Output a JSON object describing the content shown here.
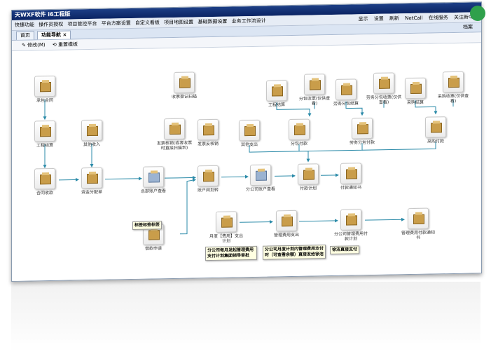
{
  "title": "天WXF软件 i6工程版",
  "menu": [
    "快捷功能",
    "操作员授权",
    "项目管控平台",
    "平台方案设置",
    "自定义看板",
    "项目地图设置",
    "基础数据设置",
    "业务工作流设计"
  ],
  "right_menu": [
    "显示",
    "设置",
    "刷新",
    "NetCall",
    "在线服务",
    "关注新中大"
  ],
  "right_extra": "档案",
  "tabs": [
    "首页",
    "功能导航"
  ],
  "toolbar": {
    "edit": "修改(M)",
    "reset": "重置模板"
  },
  "nodes": {
    "n1": "承包合同",
    "n2": "工程结算",
    "n3": "其他收入",
    "n4": "合同收款",
    "n5": "资金分配单",
    "n6": "收票登记扫描",
    "n7": "发票核销(或者收票时直接扫描到)",
    "n8": "发票反核销",
    "n9": "总部账户查看",
    "n10": "借款申请",
    "n11": "账户间划转",
    "n12": "分公司账户查看",
    "n13": "工程结算",
    "n14": "分包收票(仅供查看)",
    "n15": "劳务分包结算",
    "n16": "劳务分包收票(仅供查看)",
    "n17": "采购结算",
    "n18": "采购收票(仅供查看)",
    "n19": "其他支出",
    "n20": "分包付款",
    "n21": "劳务分包付款",
    "n22": "采购付款",
    "n23": "付款计划",
    "n24": "付款通知书",
    "n25": "月度【费用】支出计划",
    "n26": "管理费用支出",
    "n27": "分公司管理费用付款计划",
    "n28": "管理费用付款通知书"
  },
  "notes": {
    "tag": "标签标签标签",
    "note1": "分公司每月发起管理费用支付计划集团领导审批",
    "note2": "分公司月度计划内管理费用支付时（可查看余额）直接发给徐洁",
    "note3": "徐洁直接支付"
  }
}
